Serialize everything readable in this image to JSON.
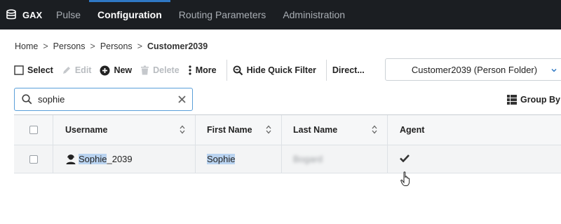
{
  "nav": {
    "brand": "GAX",
    "tabs": [
      {
        "label": "Pulse",
        "active": false
      },
      {
        "label": "Configuration",
        "active": true
      },
      {
        "label": "Routing Parameters",
        "active": false
      },
      {
        "label": "Administration",
        "active": false
      }
    ],
    "accent_color": "#2f78c4"
  },
  "breadcrumb": {
    "items": [
      "Home",
      "Persons",
      "Persons"
    ],
    "current": "Customer2039"
  },
  "toolbar": {
    "select": "Select",
    "edit": "Edit",
    "new": "New",
    "delete": "Delete",
    "more": "More",
    "hide_quick_filter": "Hide Quick Filter",
    "directory": "Direct...",
    "folder": "Customer2039 (Person Folder)"
  },
  "search": {
    "value": "sophie"
  },
  "group_by": "Group By",
  "table": {
    "columns": [
      "Username",
      "First Name",
      "Last Name",
      "Agent"
    ],
    "rows": [
      {
        "username_match": "Sophie",
        "username_rest": "_2039",
        "first_name": "Sophie",
        "last_name": "Bogard",
        "agent": true
      }
    ]
  }
}
